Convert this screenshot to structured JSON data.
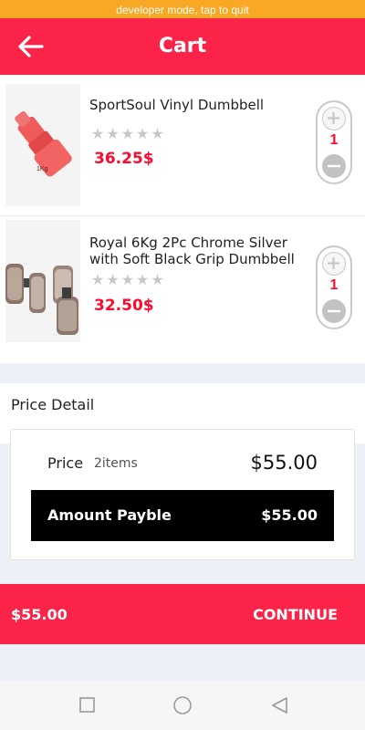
{
  "status_bar": {
    "text": "developer mode, tap to quit"
  },
  "header": {
    "title": "Cart",
    "back_icon": "arrow-left-icon"
  },
  "cart": {
    "items": [
      {
        "name": "SportSoul Vinyl Dumbbell",
        "rating_stars": "★★★★★",
        "rating": 0,
        "price": "36.25$",
        "quantity": "1",
        "image_label": "1Kg"
      },
      {
        "name": "Royal 6Kg 2Pc Chrome Silver with Soft Black Grip Dumbbell",
        "rating_stars": "★★★★★",
        "rating": 0,
        "price": "32.50$",
        "quantity": "1"
      }
    ]
  },
  "price_detail": {
    "title": "Price Detail",
    "price_label": "Price",
    "items_count": "2items",
    "price_total": "$55.00",
    "amount_label": "Amount Payble",
    "amount_value": "$55.00"
  },
  "footer": {
    "total": "$55.00",
    "continue_label": "CONTINUE"
  },
  "colors": {
    "accent": "#fb2448",
    "price": "#ff0a2e",
    "status_bar": "#f9a825"
  },
  "navigation": {
    "icons": [
      "square-icon",
      "circle-icon",
      "back-triangle-icon"
    ]
  }
}
